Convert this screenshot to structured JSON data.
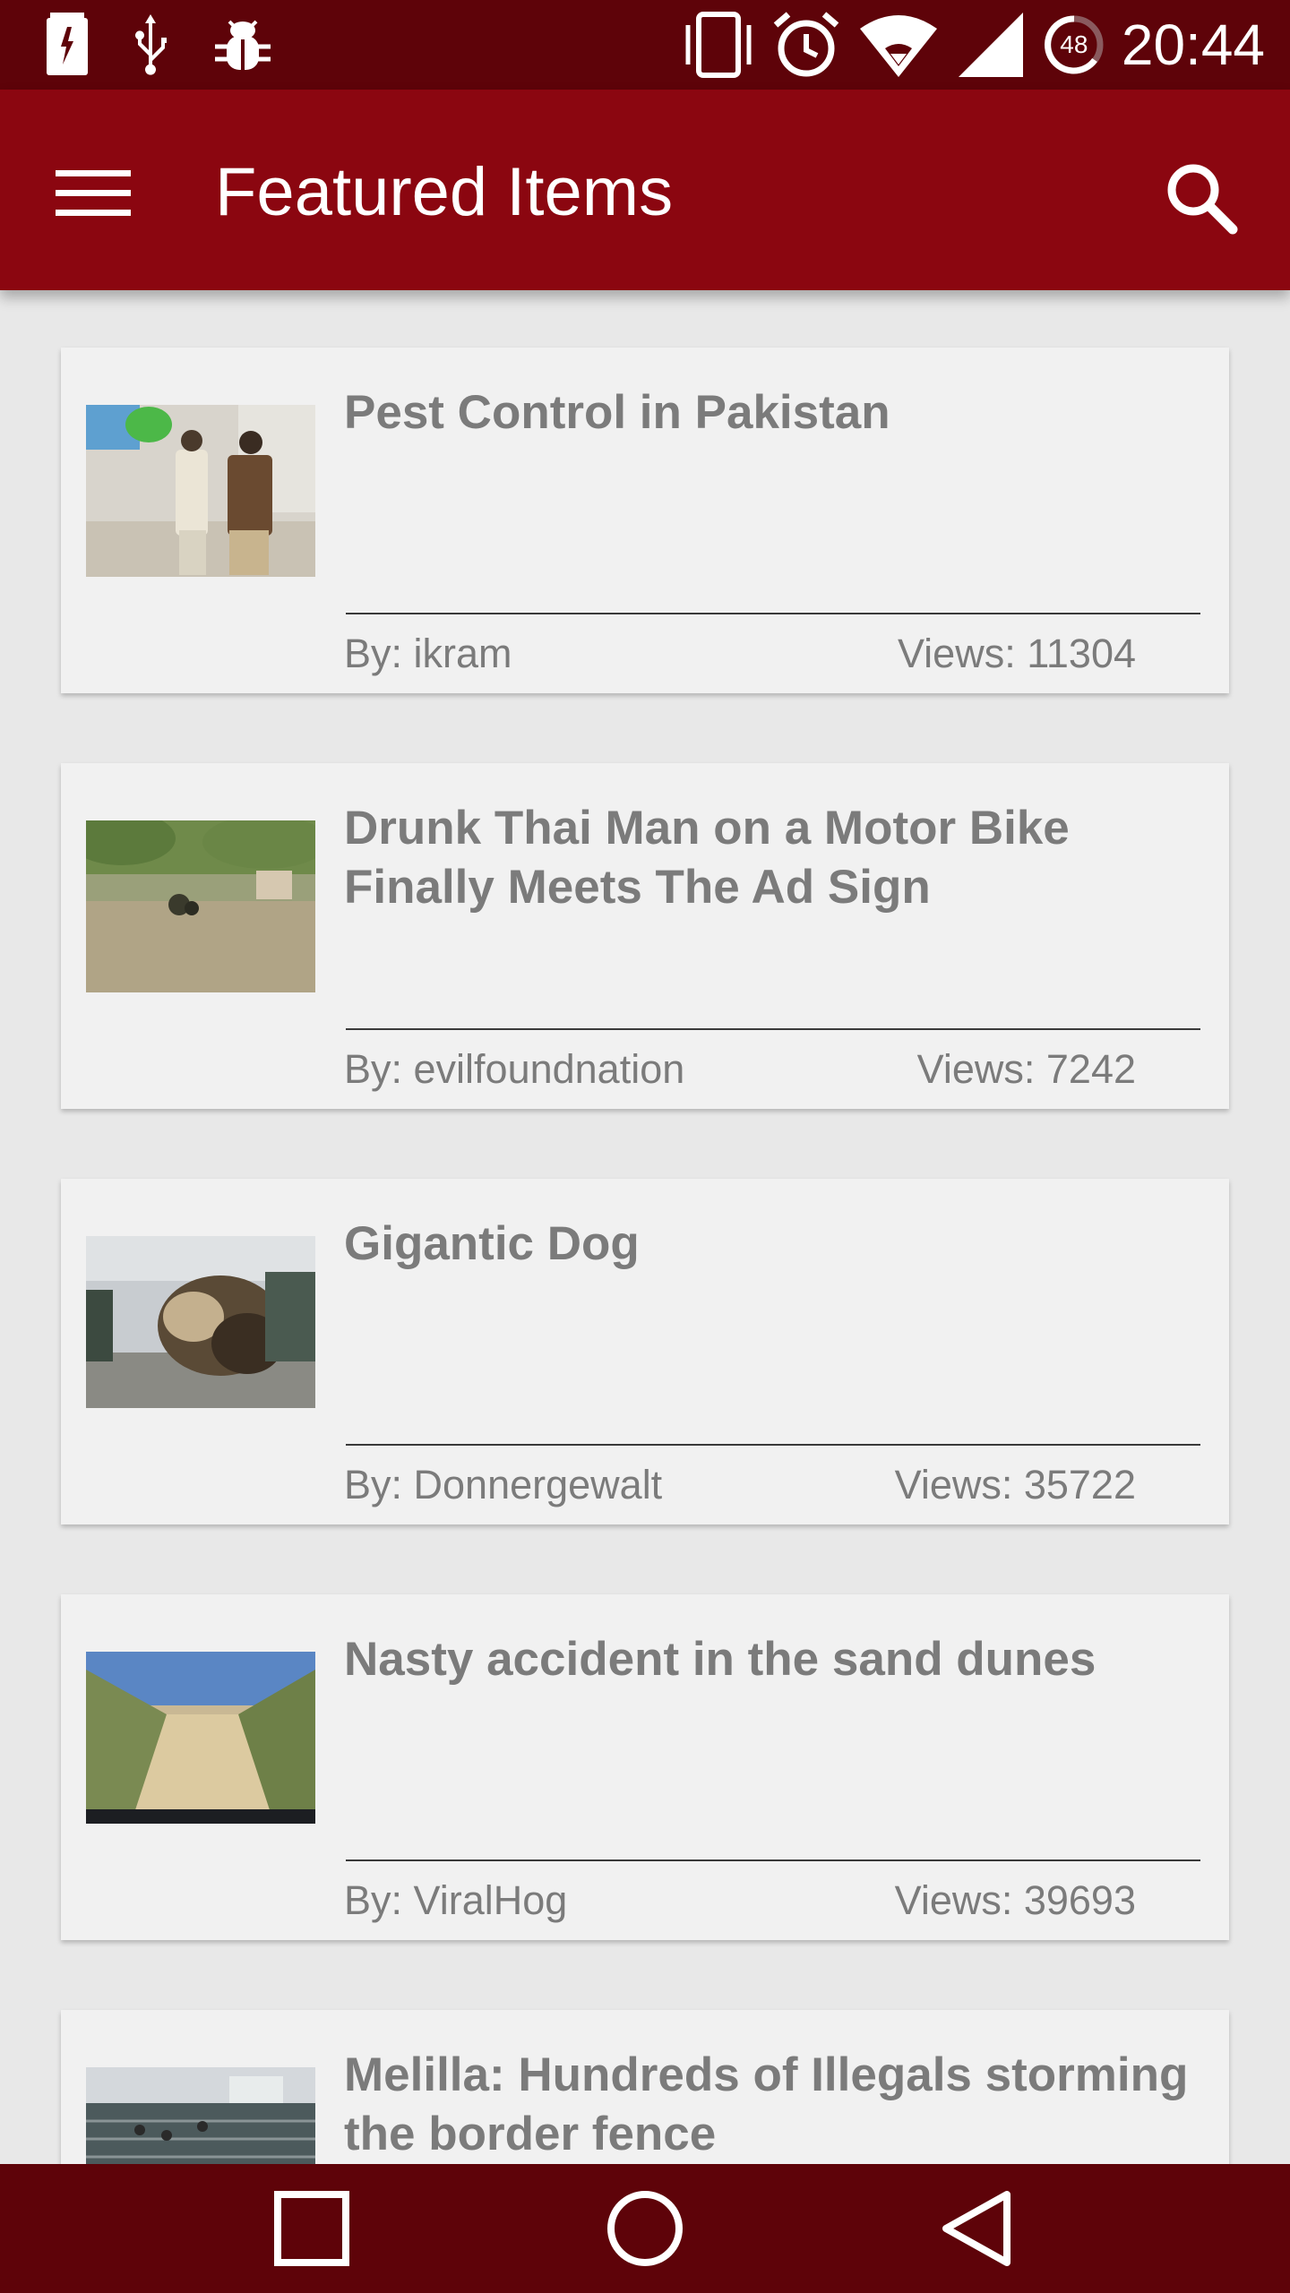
{
  "status_bar": {
    "battery_percent": "48",
    "time": "20:44",
    "icons": [
      "battery-charging-icon",
      "usb-icon",
      "debug-bug-icon",
      "vibrate-icon",
      "alarm-icon",
      "wifi-icon",
      "cell-signal-icon"
    ]
  },
  "app_bar": {
    "title": "Featured Items",
    "menu_icon": "hamburger-menu-icon",
    "search_icon": "search-icon",
    "color": "#8b0610"
  },
  "colors": {
    "status_bar": "#5e0309",
    "nav_bar": "#5e0309",
    "card_bg": "#f1f1f1",
    "text": "#7b7b7b"
  },
  "feed": {
    "items": [
      {
        "title": "Pest Control in Pakistan",
        "author": "By: ikram",
        "views": "Views: 11304"
      },
      {
        "title": "Drunk Thai Man on a Motor Bike Finally Meets The Ad Sign",
        "author": "By: evilfoundnation",
        "views": "Views: 7242"
      },
      {
        "title": "Gigantic Dog",
        "author": "By: Donnergewalt",
        "views": "Views: 35722"
      },
      {
        "title": "Nasty accident in the sand dunes",
        "author": "By: ViralHog",
        "views": "Views: 39693"
      },
      {
        "title": "Melilla: Hundreds of Illegals storming the border fence",
        "author": "",
        "views": ""
      }
    ]
  },
  "nav_bar": {
    "buttons": [
      "recents-square-icon",
      "home-circle-icon",
      "back-triangle-icon"
    ]
  }
}
